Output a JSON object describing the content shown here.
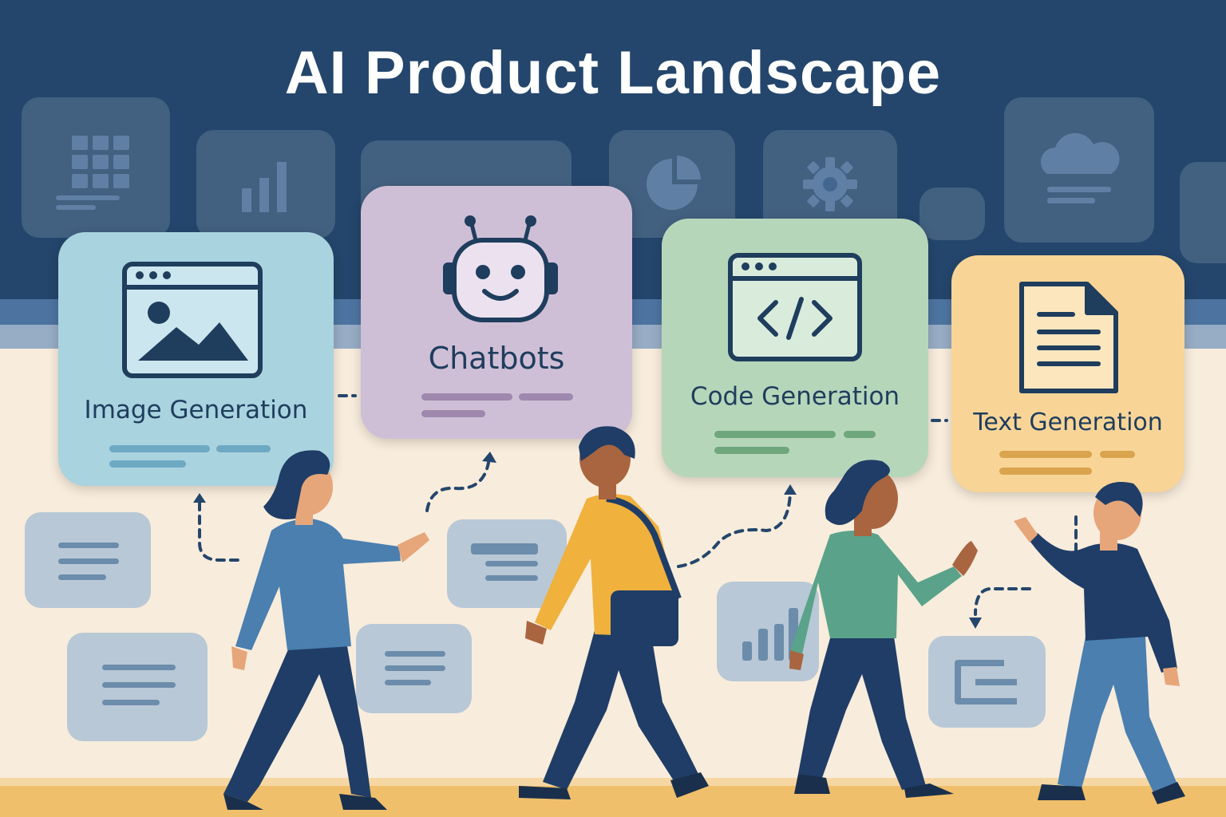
{
  "title": "AI Product Landscape",
  "categories": [
    {
      "label": "Image Generation",
      "icon": "image-window-icon",
      "color": "#a9d3df"
    },
    {
      "label": "Chatbots",
      "icon": "robot-icon",
      "color": "#cfbfd6"
    },
    {
      "label": "Code Generation",
      "icon": "code-window-icon",
      "color": "#b6d6ba"
    },
    {
      "label": "Text Generation",
      "icon": "document-icon",
      "color": "#f8d597"
    }
  ],
  "colors": {
    "header": "#24466c",
    "background": "#f8ecdc",
    "floor": "#f0bf6b",
    "icon_stroke": "#1f3d5d"
  }
}
